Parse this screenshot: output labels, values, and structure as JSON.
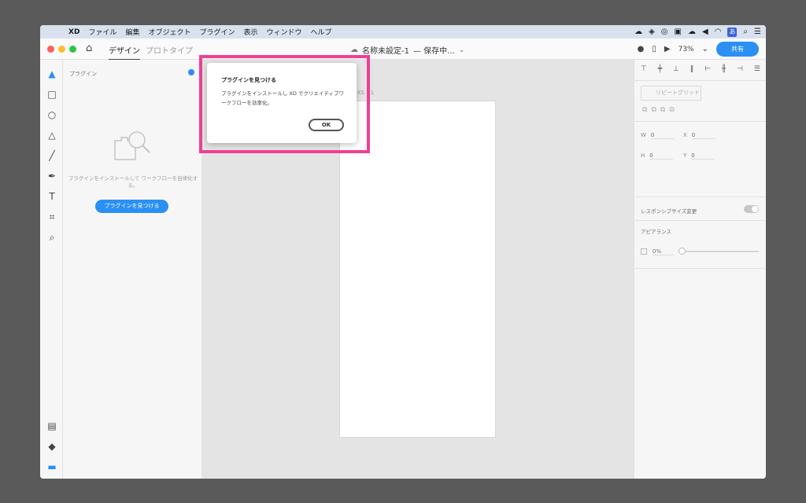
{
  "menubar": {
    "app": "XD",
    "items": [
      "ファイル",
      "編集",
      "オブジェクト",
      "プラグイン",
      "表示",
      "ウィンドウ",
      "ヘルプ"
    ],
    "ime": "あ"
  },
  "titlebar": {
    "tab_design": "デザイン",
    "tab_prototype": "プロトタイプ",
    "doc_name": "名称未設定-1",
    "doc_status": "— 保存中...",
    "zoom": "73%",
    "share": "共有"
  },
  "plugins_panel": {
    "header": "プラグイン",
    "description": "プラグインをインストールして ワークフローを自律化する。",
    "find_button": "プラグインを見つける"
  },
  "canvas": {
    "artboard_label": "e XS – 1"
  },
  "props": {
    "repeat_grid": "リピートグリッド",
    "w_label": "W",
    "w_value": "0",
    "h_label": "H",
    "h_value": "0",
    "x_label": "X",
    "x_value": "0",
    "y_label": "Y",
    "y_value": "0",
    "responsive": "レスポンシブサイズ変更",
    "appearance": "アピアランス",
    "opacity": "0%"
  },
  "dialog": {
    "title": "プラグインを見つける",
    "body": "プラグインをインストールし XD でクリエイティブワークフローを効率化。",
    "ok": "OK"
  },
  "colors": {
    "accent": "#2b8ff3",
    "highlight": "#ef3f95"
  }
}
